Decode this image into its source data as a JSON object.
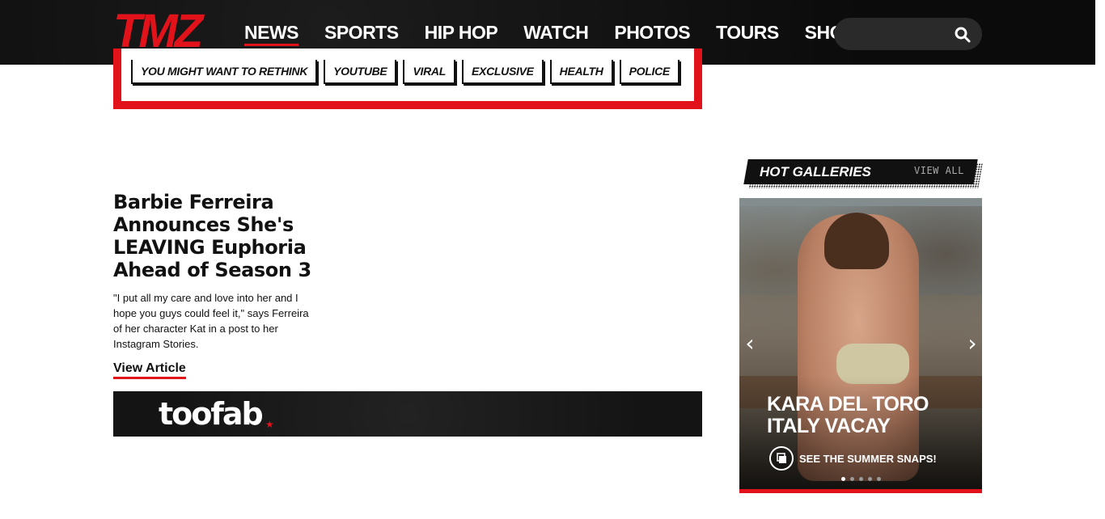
{
  "header": {
    "logo_text": "TMZ",
    "nav": [
      "NEWS",
      "SPORTS",
      "HIP HOP",
      "WATCH",
      "PHOTOS",
      "TOURS",
      "SHOP"
    ],
    "active_nav": "NEWS",
    "search": {
      "placeholder": "",
      "value": ""
    }
  },
  "tags": [
    "YOU MIGHT WANT TO RETHINK",
    "YOUTUBE",
    "VIRAL",
    "EXCLUSIVE",
    "HEALTH",
    "POLICE"
  ],
  "article": {
    "title": "Barbie Ferreira Announces She's LEAVING Euphoria Ahead of Season 3",
    "description": "\"I put all my care and love into her and I hope you guys could feel it,\" says Ferreira of her character Kat in a post to her Instagram Stories.",
    "link_label": "View Article"
  },
  "banner": {
    "logo_text": "toofab",
    "star": "★"
  },
  "hot_galleries": {
    "title": "HOT GALLERIES",
    "view_all_label": "VIEW ALL",
    "slide": {
      "title": "KARA DEL TORO ITALY VACAY",
      "cta_label": "SEE THE SUMMER SNAPS!"
    },
    "dots_count": 5,
    "active_dot": 0,
    "prev_arrow": "‹",
    "next_arrow": "›"
  },
  "colors": {
    "brand_red": "#e2121b",
    "header_bg": "#111111"
  }
}
